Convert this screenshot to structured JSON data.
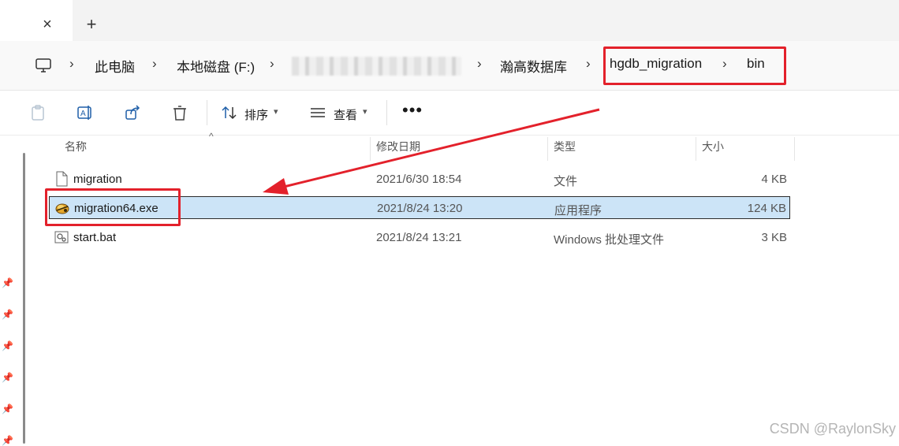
{
  "window": {
    "tab_close": "×",
    "new_tab": "+"
  },
  "breadcrumb": {
    "items": [
      "此电脑",
      "本地磁盘 (F:)",
      "瀚高数据库",
      "hgdb_migration",
      "bin"
    ],
    "separator": "›",
    "blurred_segment": true
  },
  "toolbar": {
    "sort_label": "排序",
    "view_label": "查看",
    "more_label": "•••"
  },
  "columns": {
    "name": "名称",
    "modified": "修改日期",
    "type": "类型",
    "size": "大小"
  },
  "files": [
    {
      "name": "migration",
      "modified": "2021/6/30 18:54",
      "type": "文件",
      "size": "4 KB",
      "icon": "blank-file-icon",
      "selected": false
    },
    {
      "name": "migration64.exe",
      "modified": "2021/8/24 13:20",
      "type": "应用程序",
      "size": "124 KB",
      "icon": "application-exe-icon",
      "selected": true
    },
    {
      "name": "start.bat",
      "modified": "2021/8/24 13:21",
      "type": "Windows 批处理文件",
      "size": "3 KB",
      "icon": "batch-file-icon",
      "selected": false
    }
  ],
  "annotation": {
    "color": "#e3212b",
    "highlight_color": "#cce4f7"
  },
  "watermark": "CSDN @RaylonSky"
}
